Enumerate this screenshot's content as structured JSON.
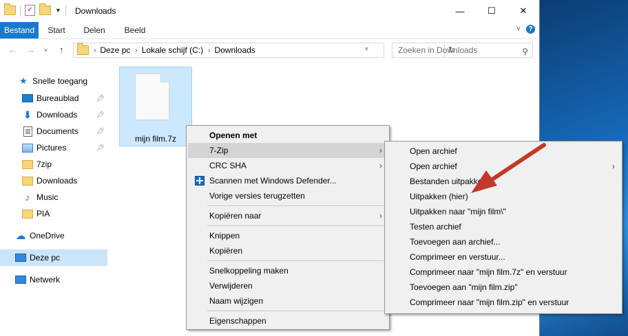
{
  "window": {
    "title": "Downloads"
  },
  "ribbon": {
    "tabs": [
      "Bestand",
      "Start",
      "Delen",
      "Beeld"
    ]
  },
  "address": {
    "crumbs": [
      "Deze pc",
      "Lokale schijf (C:)",
      "Downloads"
    ]
  },
  "search": {
    "placeholder": "Zoeken in Downloads"
  },
  "sidebar": {
    "quick_access": "Snelle toegang",
    "items": [
      {
        "label": "Bureaublad",
        "icon": "desktop-icon",
        "pinned": true
      },
      {
        "label": "Downloads",
        "icon": "download-icon",
        "pinned": true
      },
      {
        "label": "Documents",
        "icon": "document-icon",
        "pinned": true
      },
      {
        "label": "Pictures",
        "icon": "pictures-icon",
        "pinned": true
      },
      {
        "label": "7zip",
        "icon": "folder-icon",
        "pinned": false
      },
      {
        "label": "Downloads",
        "icon": "folder-icon",
        "pinned": false
      },
      {
        "label": "Music",
        "icon": "music-icon",
        "pinned": false
      },
      {
        "label": "PIA",
        "icon": "folder-icon",
        "pinned": false
      }
    ],
    "onedrive": "OneDrive",
    "this_pc": "Deze pc",
    "network": "Netwerk"
  },
  "file": {
    "name": "mijn film.7z",
    "selected": true
  },
  "context_menu": {
    "items": [
      {
        "label": "Openen met",
        "bold": true
      },
      {
        "label": "7-Zip",
        "submenu": true,
        "highlighted": true
      },
      {
        "label": "CRC SHA",
        "submenu": true
      },
      {
        "label": "Scannen met Windows Defender...",
        "icon": "windows-defender-icon"
      },
      {
        "label": "Vorige versies terugzetten"
      },
      {
        "label": "Kopiëren naar",
        "submenu": true
      },
      {
        "label": "Knippen"
      },
      {
        "label": "Kopiëren"
      },
      {
        "label": "Snelkoppeling maken"
      },
      {
        "label": "Verwijderen"
      },
      {
        "label": "Naam wijzigen"
      },
      {
        "label": "Eigenschappen"
      }
    ]
  },
  "submenu_7zip": {
    "items": [
      {
        "label": "Open archief"
      },
      {
        "label": "Open archief",
        "submenu": true
      },
      {
        "label": "Bestanden uitpakken..."
      },
      {
        "label": "Uitpakken (hier)"
      },
      {
        "label": "Uitpakken naar \"mijn film\\\""
      },
      {
        "label": "Testen archief"
      },
      {
        "label": "Toevoegen aan archief..."
      },
      {
        "label": "Comprimeer en verstuur..."
      },
      {
        "label": "Comprimeer naar \"mijn film.7z\" en verstuur"
      },
      {
        "label": "Toevoegen aan \"mijn film.zip\""
      },
      {
        "label": "Comprimeer naar \"mijn film.zip\" en verstuur"
      }
    ]
  },
  "colors": {
    "accent": "#1979ca",
    "selection": "#cce8ff",
    "annotation_arrow": "#c0392b"
  }
}
